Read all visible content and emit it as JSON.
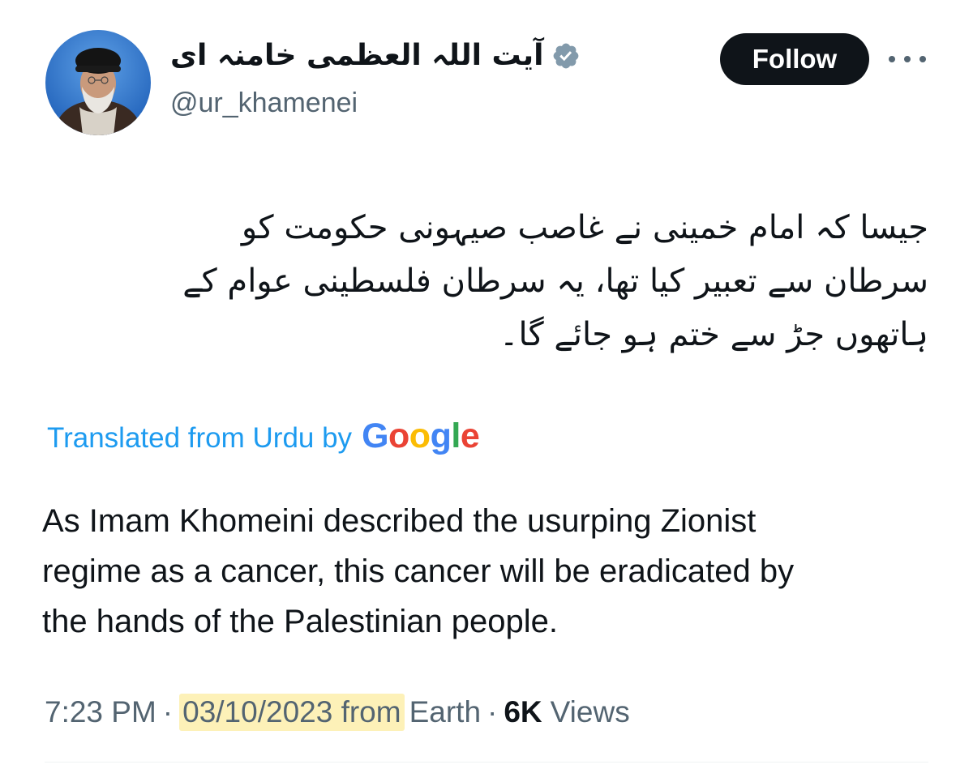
{
  "author": {
    "display_name": "آیت اللہ العظمی خامنہ ای",
    "handle": "@ur_khamenei",
    "verified": true,
    "avatar_icon": "profile-photo"
  },
  "actions": {
    "follow_label": "Follow",
    "more_icon": "more-horizontal-icon"
  },
  "tweet": {
    "urdu_lines": [
      "جیسا کہ امام خمینی نے غاصب صیہونی حکومت کو",
      "سرطان سے تعبیر کیا تھا، یہ سرطان فلسطینی عوام کے",
      "ہاتھوں جڑ سے ختم ہو جائے گا۔"
    ],
    "translation_label": "Translated from Urdu by",
    "translation_provider": [
      "G",
      "o",
      "o",
      "g",
      "l",
      "e"
    ],
    "english_lines": [
      "As Imam Khomeini described the usurping Zionist",
      "regime as a cancer, this cancer will be eradicated by",
      "the hands of the Palestinian people."
    ]
  },
  "meta": {
    "time": "7:23 PM",
    "date_from": "03/10/2023 from",
    "location": "Earth",
    "views_count": "6K",
    "views_label": "Views",
    "separator": "·"
  },
  "colors": {
    "link": "#1d9bf0",
    "secondary_text": "#536471",
    "primary_text": "#0f1419",
    "verified_badge": "#829aab",
    "highlight": "#fdf1b8"
  }
}
